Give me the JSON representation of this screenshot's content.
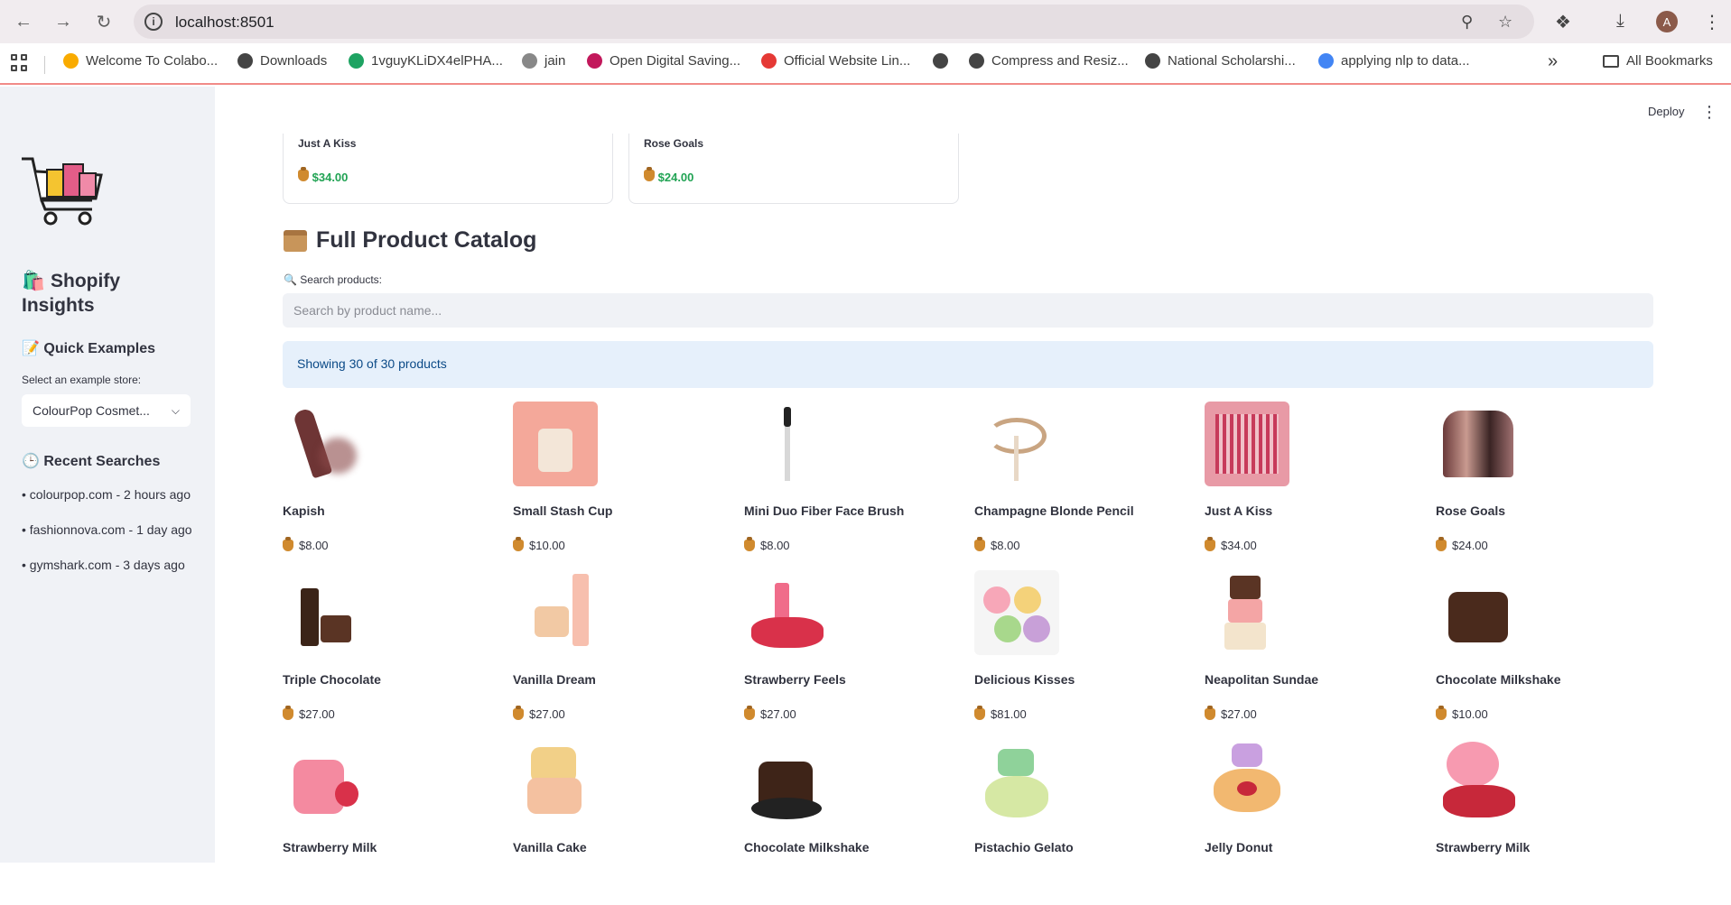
{
  "browser": {
    "url": "localhost:8501",
    "bookmarks": [
      {
        "label": "Welcome To Colabo...",
        "icon": "colab-icon",
        "color": "#f9ab00"
      },
      {
        "label": "Downloads",
        "icon": "download-icon",
        "color": "#444444"
      },
      {
        "label": "1vguyKLiDX4elPHA...",
        "icon": "drive-icon",
        "color": "#1ea362"
      },
      {
        "label": "jain",
        "icon": "jain-icon",
        "color": "#888888"
      },
      {
        "label": "Open Digital Saving...",
        "icon": "bank-icon",
        "color": "#c2185b"
      },
      {
        "label": "Official Website Lin...",
        "icon": "target-icon",
        "color": "#e53935"
      },
      {
        "label": "",
        "icon": "globe-icon",
        "color": "#444444"
      },
      {
        "label": "Compress and Resiz...",
        "icon": "globe-icon",
        "color": "#444444"
      },
      {
        "label": "National Scholarshi...",
        "icon": "globe-icon",
        "color": "#444444"
      },
      {
        "label": "applying nlp to data...",
        "icon": "google-icon",
        "color": "#4285f4"
      }
    ],
    "all_bookmarks": "All Bookmarks",
    "avatar_letter": "A"
  },
  "sidebar": {
    "title_icon": "🛍️",
    "title": "Shopify Insights",
    "quick_examples_icon": "📝",
    "quick_examples": "Quick Examples",
    "select_label": "Select an example store:",
    "select_value": "ColourPop Cosmet...",
    "recent_icon": "🕒",
    "recent_title": "Recent Searches",
    "recent": [
      "• colourpop.com - 2 hours ago",
      "• fashionnova.com - 1 day ago",
      "• gymshark.com - 3 days ago"
    ]
  },
  "header": {
    "deploy": "Deploy"
  },
  "top_cards": [
    {
      "name": "Just A Kiss",
      "price": "$34.00"
    },
    {
      "name": "Rose Goals",
      "price": "$24.00"
    }
  ],
  "catalog": {
    "title": "Full Product Catalog",
    "search_label": "🔍 Search products:",
    "search_placeholder": "Search by product name...",
    "showing": "Showing 30 of 30 products",
    "products": [
      {
        "name": "Kapish",
        "price": "$8.00",
        "thumb": "lipstick-brown"
      },
      {
        "name": "Small Stash Cup",
        "price": "$10.00",
        "thumb": "cup-peach"
      },
      {
        "name": "Mini Duo Fiber Face Brush",
        "price": "$8.00",
        "thumb": "brush"
      },
      {
        "name": "Champagne Blonde Pencil",
        "price": "$8.00",
        "thumb": "pencil-scribble"
      },
      {
        "name": "Just A Kiss",
        "price": "$34.00",
        "thumb": "lip-kit-pink"
      },
      {
        "name": "Rose Goals",
        "price": "$24.00",
        "thumb": "swatches"
      },
      {
        "name": "Triple Chocolate",
        "price": "$27.00",
        "thumb": "chocolate-set"
      },
      {
        "name": "Vanilla Dream",
        "price": "$27.00",
        "thumb": "vanilla-set"
      },
      {
        "name": "Strawberry Feels",
        "price": "$27.00",
        "thumb": "strawberry-set"
      },
      {
        "name": "Delicious Kisses",
        "price": "$81.00",
        "thumb": "macaron-jars"
      },
      {
        "name": "Neapolitan Sundae",
        "price": "$27.00",
        "thumb": "sundae-stack"
      },
      {
        "name": "Chocolate Milkshake",
        "price": "$10.00",
        "thumb": "choc-jar"
      },
      {
        "name": "Strawberry Milk",
        "price": "",
        "thumb": "strawberry-jar"
      },
      {
        "name": "Vanilla Cake",
        "price": "",
        "thumb": "vanilla-cake-jar"
      },
      {
        "name": "Chocolate Milkshake",
        "price": "",
        "thumb": "choc-cookie-jar"
      },
      {
        "name": "Pistachio Gelato",
        "price": "",
        "thumb": "pistachio-jar"
      },
      {
        "name": "Jelly Donut",
        "price": "",
        "thumb": "donut-jar"
      },
      {
        "name": "Strawberry Milk",
        "price": "",
        "thumb": "strawberry-tube-jar"
      }
    ]
  }
}
